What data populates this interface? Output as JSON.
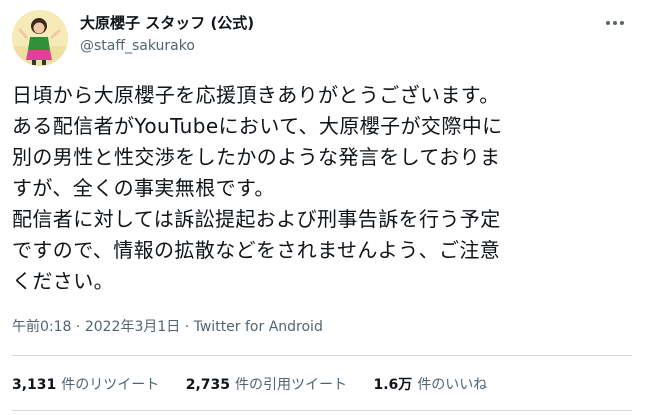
{
  "author": {
    "display_name": "大原櫻子 スタッフ (公式)",
    "handle": "@staff_sakurako",
    "avatar_icon": "profile-photo"
  },
  "tweet": {
    "lines": [
      "日頃から大原櫻子を応援頂きありがとうございます。",
      "ある配信者がYouTubeにおいて、大原櫻子が交際中に",
      "別の男性と性交渉をしたかのような発言をしておりま",
      "すが、全くの事実無根です。",
      "配信者に対しては訴訟提起および刑事告訴を行う予定",
      "ですので、情報の拡散などをされませんよう、ご注意",
      "ください。"
    ],
    "time": "午前0:18",
    "separator": "·",
    "date": "2022年3月1日",
    "source": "Twitter for Android"
  },
  "stats": {
    "retweets": {
      "count": "3,131",
      "label": "件のリツイート"
    },
    "quotes": {
      "count": "2,735",
      "label": "件の引用ツイート"
    },
    "likes": {
      "count": "1.6万",
      "label": "件のいいね"
    }
  },
  "colors": {
    "text": "#0f1419",
    "secondary": "#536471",
    "divider": "#cfd9de"
  }
}
